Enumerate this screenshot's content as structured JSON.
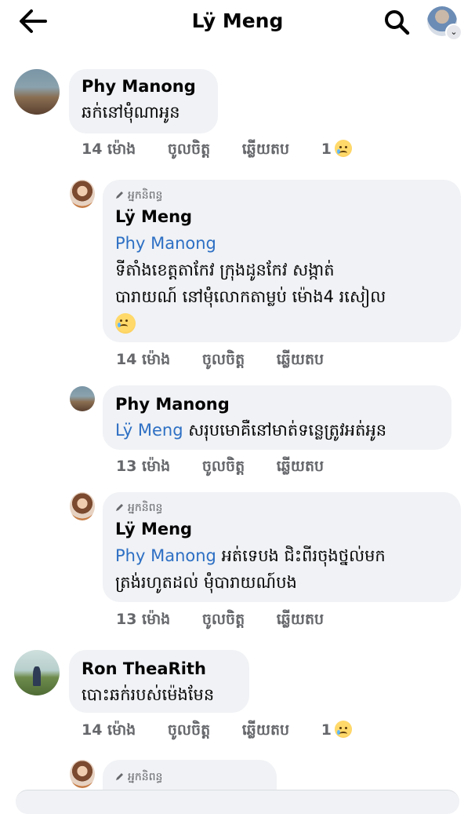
{
  "header": {
    "title": "Lÿ Meng"
  },
  "comments": [
    {
      "author": "Phy Manong",
      "text": "ឆក់នៅម៉ុំណាអូន",
      "time": "14 ម៉ោង",
      "like": "ចូលចិត្ត",
      "reply": "ឆ្លើយតប",
      "reaction_count": "1"
    },
    {
      "author_tag": "អ្នកនិពន្ធ",
      "author": "Lÿ Meng",
      "mention": "Phy Manong",
      "line1": "ទីតាំងខេត្តតាកែវ ក្រុងដូនកែវ សង្កាត់",
      "line2": "បារាយណ៍ នៅម៉ុំលោកតាម្លប់ ម៉ោង4 រសៀល",
      "time": "14 ម៉ោង",
      "like": "ចូលចិត្ត",
      "reply": "ឆ្លើយតប"
    },
    {
      "author": "Phy Manong",
      "mention": "Lÿ Meng",
      "text": "សរុបមោគឺនៅមាត់ទន្លេត្រូវអត់អូន",
      "time": "13 ម៉ោង",
      "like": "ចូលចិត្ត",
      "reply": "ឆ្លើយតប"
    },
    {
      "author_tag": "អ្នកនិពន្ធ",
      "author": "Lÿ Meng",
      "mention": "Phy Manong",
      "line1": "អត់ទេបង ជិះពីរចុងថ្នល់មក",
      "line2": "ត្រង់រហូតដល់ ម៉ុំបារាយណ៍បង",
      "time": "13 ម៉ោង",
      "like": "ចូលចិត្ត",
      "reply": "ឆ្លើយតប"
    },
    {
      "author": "Ron TheaRith",
      "text": "បោះឆក់របស់ម៉េងមែន",
      "time": "14 ម៉ោង",
      "like": "ចូលចិត្ត",
      "reply": "ឆ្លើយតប",
      "reaction_count": "1"
    },
    {
      "author_tag": "អ្នកនិពន្ធ"
    }
  ]
}
